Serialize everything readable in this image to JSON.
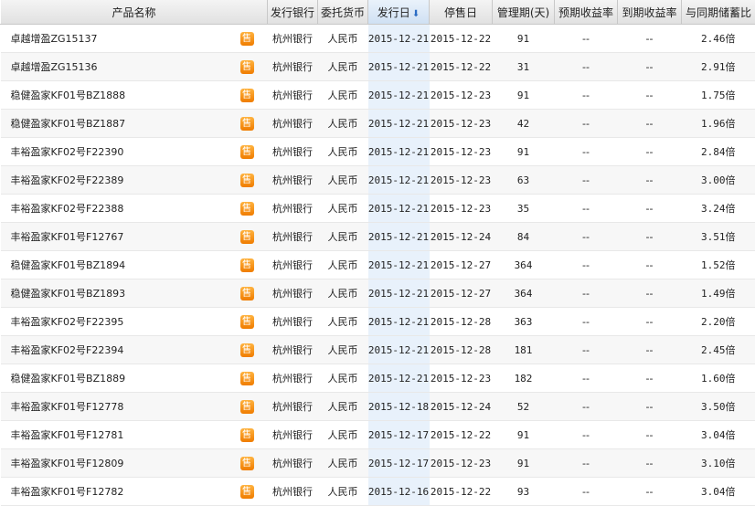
{
  "headers": {
    "product": "产品名称",
    "bank": "发行银行",
    "currency": "委托货币",
    "issue_date": "发行日",
    "stop_date": "停售日",
    "period": "管理期(天)",
    "expected_yield": "预期收益率",
    "actual_yield": "到期收益率",
    "ratio": "与同期储蓄比"
  },
  "sort_icon": "arrow-down-icon",
  "colors": {
    "badge": "#f08a00",
    "sort_arrow": "#2b6cc4",
    "sorted_column": "#e8f1fb"
  },
  "rows": [
    {
      "product": "卓越增盈ZG15137",
      "badge": "售",
      "bank": "杭州银行",
      "currency": "人民币",
      "issue_date": "2015-12-21",
      "stop_date": "2015-12-22",
      "period": "91",
      "expected_yield": "--",
      "actual_yield": "--",
      "ratio": "2.46倍"
    },
    {
      "product": "卓越增盈ZG15136",
      "badge": "售",
      "bank": "杭州银行",
      "currency": "人民币",
      "issue_date": "2015-12-21",
      "stop_date": "2015-12-22",
      "period": "31",
      "expected_yield": "--",
      "actual_yield": "--",
      "ratio": "2.91倍"
    },
    {
      "product": "稳健盈家KF01号BZ1888",
      "badge": "售",
      "bank": "杭州银行",
      "currency": "人民币",
      "issue_date": "2015-12-21",
      "stop_date": "2015-12-23",
      "period": "91",
      "expected_yield": "--",
      "actual_yield": "--",
      "ratio": "1.75倍"
    },
    {
      "product": "稳健盈家KF01号BZ1887",
      "badge": "售",
      "bank": "杭州银行",
      "currency": "人民币",
      "issue_date": "2015-12-21",
      "stop_date": "2015-12-23",
      "period": "42",
      "expected_yield": "--",
      "actual_yield": "--",
      "ratio": "1.96倍"
    },
    {
      "product": "丰裕盈家KF02号F22390",
      "badge": "售",
      "bank": "杭州银行",
      "currency": "人民币",
      "issue_date": "2015-12-21",
      "stop_date": "2015-12-23",
      "period": "91",
      "expected_yield": "--",
      "actual_yield": "--",
      "ratio": "2.84倍"
    },
    {
      "product": "丰裕盈家KF02号F22389",
      "badge": "售",
      "bank": "杭州银行",
      "currency": "人民币",
      "issue_date": "2015-12-21",
      "stop_date": "2015-12-23",
      "period": "63",
      "expected_yield": "--",
      "actual_yield": "--",
      "ratio": "3.00倍"
    },
    {
      "product": "丰裕盈家KF02号F22388",
      "badge": "售",
      "bank": "杭州银行",
      "currency": "人民币",
      "issue_date": "2015-12-21",
      "stop_date": "2015-12-23",
      "period": "35",
      "expected_yield": "--",
      "actual_yield": "--",
      "ratio": "3.24倍"
    },
    {
      "product": "丰裕盈家KF01号F12767",
      "badge": "售",
      "bank": "杭州银行",
      "currency": "人民币",
      "issue_date": "2015-12-21",
      "stop_date": "2015-12-24",
      "period": "84",
      "expected_yield": "--",
      "actual_yield": "--",
      "ratio": "3.51倍"
    },
    {
      "product": "稳健盈家KF01号BZ1894",
      "badge": "售",
      "bank": "杭州银行",
      "currency": "人民币",
      "issue_date": "2015-12-21",
      "stop_date": "2015-12-27",
      "period": "364",
      "expected_yield": "--",
      "actual_yield": "--",
      "ratio": "1.52倍"
    },
    {
      "product": "稳健盈家KF01号BZ1893",
      "badge": "售",
      "bank": "杭州银行",
      "currency": "人民币",
      "issue_date": "2015-12-21",
      "stop_date": "2015-12-27",
      "period": "364",
      "expected_yield": "--",
      "actual_yield": "--",
      "ratio": "1.49倍"
    },
    {
      "product": "丰裕盈家KF02号F22395",
      "badge": "售",
      "bank": "杭州银行",
      "currency": "人民币",
      "issue_date": "2015-12-21",
      "stop_date": "2015-12-28",
      "period": "363",
      "expected_yield": "--",
      "actual_yield": "--",
      "ratio": "2.20倍"
    },
    {
      "product": "丰裕盈家KF02号F22394",
      "badge": "售",
      "bank": "杭州银行",
      "currency": "人民币",
      "issue_date": "2015-12-21",
      "stop_date": "2015-12-28",
      "period": "181",
      "expected_yield": "--",
      "actual_yield": "--",
      "ratio": "2.45倍"
    },
    {
      "product": "稳健盈家KF01号BZ1889",
      "badge": "售",
      "bank": "杭州银行",
      "currency": "人民币",
      "issue_date": "2015-12-21",
      "stop_date": "2015-12-23",
      "period": "182",
      "expected_yield": "--",
      "actual_yield": "--",
      "ratio": "1.60倍"
    },
    {
      "product": "丰裕盈家KF01号F12778",
      "badge": "售",
      "bank": "杭州银行",
      "currency": "人民币",
      "issue_date": "2015-12-18",
      "stop_date": "2015-12-24",
      "period": "52",
      "expected_yield": "--",
      "actual_yield": "--",
      "ratio": "3.50倍"
    },
    {
      "product": "丰裕盈家KF01号F12781",
      "badge": "售",
      "bank": "杭州银行",
      "currency": "人民币",
      "issue_date": "2015-12-17",
      "stop_date": "2015-12-22",
      "period": "91",
      "expected_yield": "--",
      "actual_yield": "--",
      "ratio": "3.04倍"
    },
    {
      "product": "丰裕盈家KF01号F12809",
      "badge": "售",
      "bank": "杭州银行",
      "currency": "人民币",
      "issue_date": "2015-12-17",
      "stop_date": "2015-12-23",
      "period": "91",
      "expected_yield": "--",
      "actual_yield": "--",
      "ratio": "3.10倍"
    },
    {
      "product": "丰裕盈家KF01号F12782",
      "badge": "售",
      "bank": "杭州银行",
      "currency": "人民币",
      "issue_date": "2015-12-16",
      "stop_date": "2015-12-22",
      "period": "93",
      "expected_yield": "--",
      "actual_yield": "--",
      "ratio": "3.04倍"
    }
  ]
}
